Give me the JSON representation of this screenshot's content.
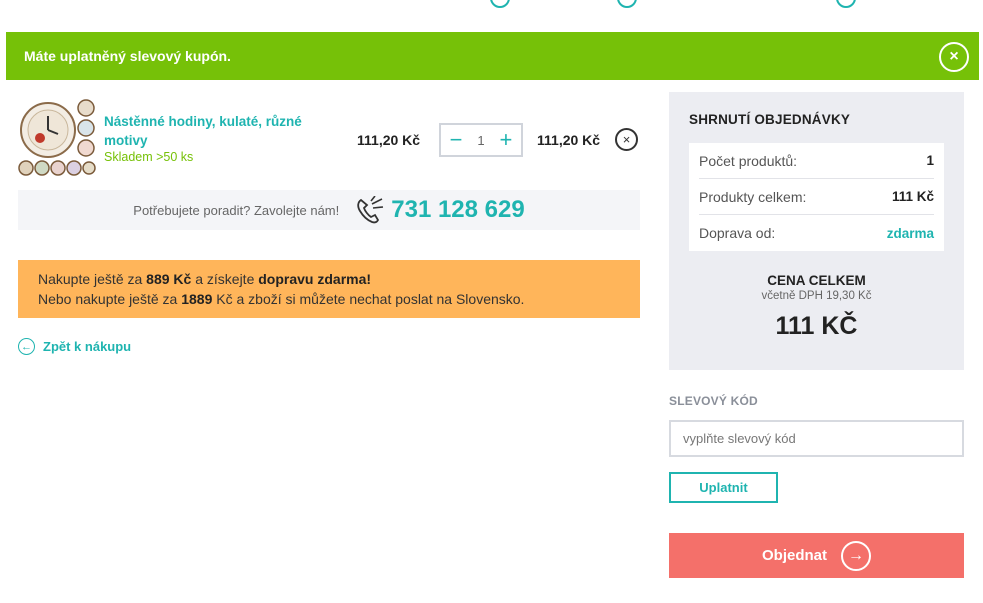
{
  "alert": {
    "message": "Máte uplatněný slevový kupón.",
    "close_icon": "×"
  },
  "cart": {
    "item": {
      "title": "Nástěnné hodiny, kulaté, různé motivy",
      "stock": "Skladem >50 ks",
      "unit_price": "111,20 Kč",
      "quantity": "1",
      "minus": "−",
      "plus": "+",
      "total_price": "111,20 Kč",
      "remove_icon": "×"
    },
    "help": {
      "text": "Potřebujete poradit? Zavolejte nám!",
      "phone": "731 128 629"
    },
    "notice": {
      "line1_a": "Nakupte ještě za ",
      "line1_amount": "889 Kč",
      "line1_b": " a získejte ",
      "line1_bold": "dopravu zdarma",
      "line1_c": "!",
      "line2_a": "Nebo nakupte ještě za ",
      "line2_amount": "1889",
      "line2_b": " Kč a zboží si můžete nechat poslat na Slovensko."
    },
    "back": {
      "label": "Zpět k nákupu",
      "icon": "←"
    }
  },
  "summary": {
    "title": "SHRNUTÍ OBJEDNÁVKY",
    "rows": [
      {
        "label": "Počet produktů:",
        "value": "1"
      },
      {
        "label": "Produkty celkem:",
        "value": "111 Kč"
      },
      {
        "label": "Doprava od:",
        "value": "zdarma"
      }
    ],
    "grand_label": "CENA CELKEM",
    "grand_vat": "včetně DPH 19,30 Kč",
    "grand_value": "111 KČ"
  },
  "discount": {
    "label": "SLEVOVÝ KÓD",
    "placeholder": "vyplňte slevový kód",
    "apply": "Uplatnit"
  },
  "order": {
    "label": "Objednat",
    "icon": "→"
  },
  "colors": {
    "teal": "#1fb4b0",
    "green": "#76c108",
    "orange": "#ffb55a",
    "salmon": "#f4706a",
    "summary_bg": "#ecedf2"
  }
}
